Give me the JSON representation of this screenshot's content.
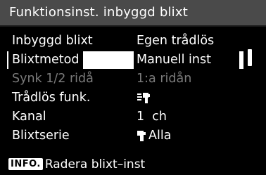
{
  "header": {
    "title": "Funktionsinst. inbyggd blixt"
  },
  "menu": {
    "items": [
      {
        "label": "Inbyggd blixt",
        "value": "Egen trådlös"
      },
      {
        "label": "Blixtmetod",
        "value": "Manuell inst"
      },
      {
        "label": "Synk 1/2 ridå",
        "value": "1:a ridån"
      },
      {
        "label": "Trådlös funk.",
        "value_icon": "wireless-flash-icon"
      },
      {
        "label": "Kanal",
        "value": "1  ch"
      },
      {
        "label": "Blixtserie",
        "value_icon": "flash-unit-icon",
        "value": "Alla"
      }
    ],
    "selected_index": 1,
    "disabled_index": 2
  },
  "footer": {
    "badge": "INFO.",
    "text": "Radera blixt–inst"
  },
  "colors": {
    "background": "#000000",
    "title_bar": "#4a4a4a",
    "disabled_text": "#7a7a7a"
  }
}
